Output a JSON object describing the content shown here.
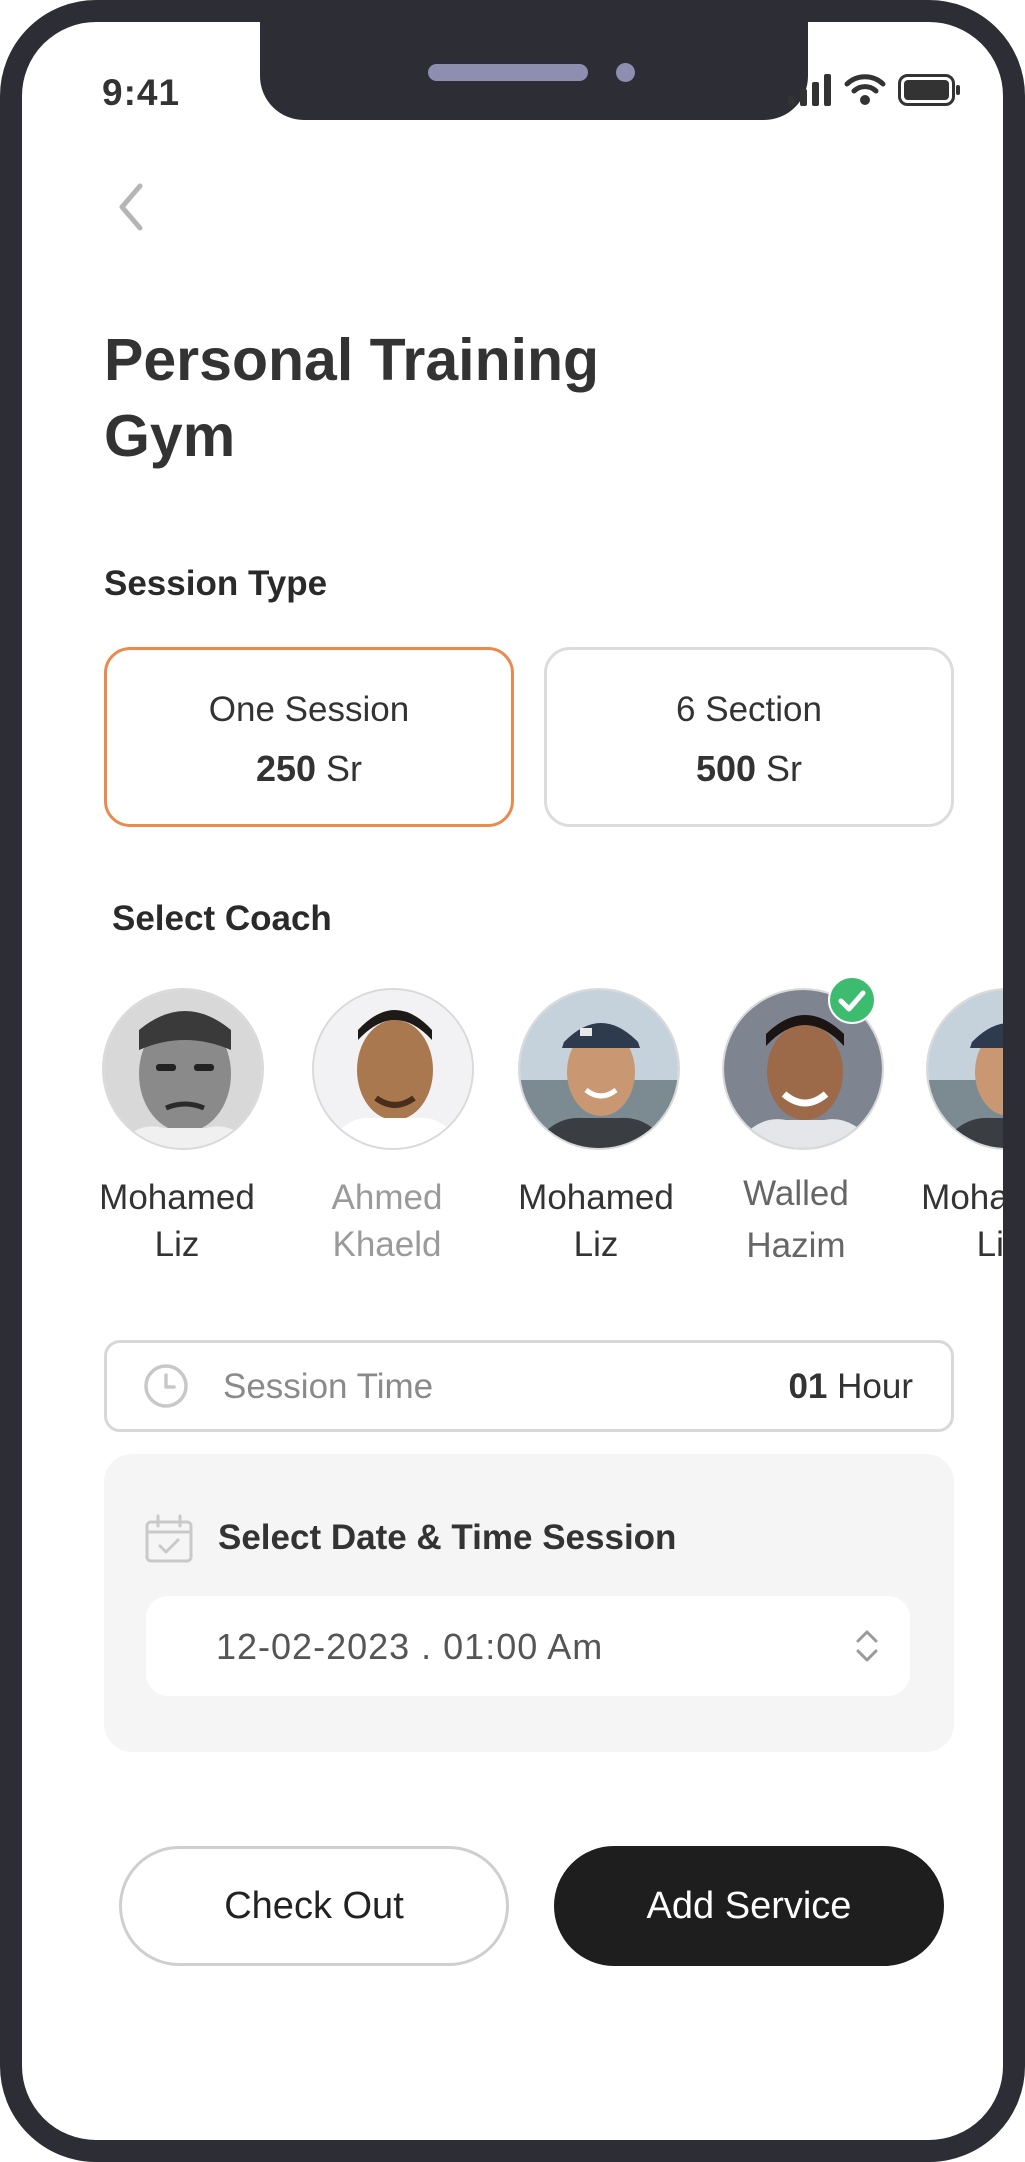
{
  "status_bar": {
    "time": "9:41"
  },
  "page": {
    "title_line1": "Personal Training",
    "title_line2": "Gym"
  },
  "session_type": {
    "label": "Session Type",
    "options": [
      {
        "name": "One Session",
        "amount": "250",
        "currency": "Sr",
        "selected": true
      },
      {
        "name": "6 Section",
        "amount": "500",
        "currency": "Sr",
        "selected": false
      }
    ]
  },
  "coach": {
    "label": "Select Coach",
    "list": [
      {
        "first": "Mohamed",
        "last": "Liz",
        "state": "normal"
      },
      {
        "first": "Ahmed",
        "last": "Khaeld",
        "state": "muted"
      },
      {
        "first": "Mohamed",
        "last": "Liz",
        "state": "normal"
      },
      {
        "first": "Walled",
        "last": "Hazim",
        "state": "selected"
      },
      {
        "first": "Mohamed",
        "last": "Liz",
        "state": "normal"
      }
    ]
  },
  "session_time": {
    "label": "Session Time",
    "value_bold": "01",
    "value_unit": "Hour"
  },
  "schedule": {
    "title": "Select Date & Time  Session",
    "value": "12-02-2023 .  01:00 Am"
  },
  "actions": {
    "checkout": "Check Out",
    "add_service": "Add Service"
  },
  "colors": {
    "accent": "#ea8a4c",
    "check": "#3dbb6e",
    "frame": "#2d2d35",
    "primary_button": "#1e1e1e"
  },
  "icons": [
    "back-chevron-icon",
    "signal-icon",
    "wifi-icon",
    "battery-icon",
    "clock-icon",
    "calendar-icon",
    "up-down-chevron-icon",
    "check-icon"
  ]
}
